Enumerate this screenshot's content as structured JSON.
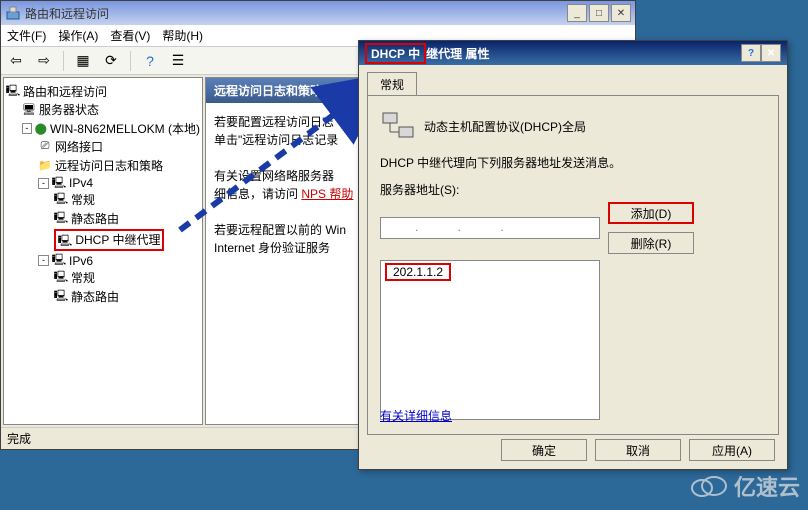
{
  "main_window": {
    "title": "路由和远程访问",
    "menu": {
      "file": "文件(F)",
      "action": "操作(A)",
      "view": "查看(V)",
      "help": "帮助(H)"
    },
    "statusbar": "完成",
    "content": {
      "header": "远程访问日志和策略",
      "p1": "若要配置远程访问日志",
      "p2_a": "单击\"远程访问日志记录",
      "p3_a": "有关设置网络略服务器",
      "p3_b": "细信息，请访问",
      "p3_link": "NPS 帮助",
      "p4_a": "若要远程配置以前的 Win",
      "p4_b": "Internet 身份验证服务"
    }
  },
  "tree": {
    "root": "路由和远程访问",
    "server_status": "服务器状态",
    "server": "WIN-8N62MELLOKM (本地)",
    "nic": "网络接口",
    "logs": "远程访问日志和策略",
    "ipv4": "IPv4",
    "general": "常规",
    "static_route": "静态路由",
    "dhcp_relay": "DHCP 中继代理",
    "ipv6": "IPv6"
  },
  "dialog": {
    "title_a": "DHCP 中",
    "title_b": "继代理 属性",
    "tab": "常规",
    "header": "动态主机配置协议(DHCP)全局",
    "description": "DHCP 中继代理向下列服务器地址发送消息。",
    "server_addr_label": "服务器地址(S):",
    "ip_value": "202.1.1.2",
    "add_btn": "添加(D)",
    "remove_btn": "删除(R)",
    "more_info": "有关详细信息",
    "ok": "确定",
    "cancel": "取消",
    "apply": "应用(A)",
    "dots": ".   .   ."
  },
  "watermark": "亿速云"
}
